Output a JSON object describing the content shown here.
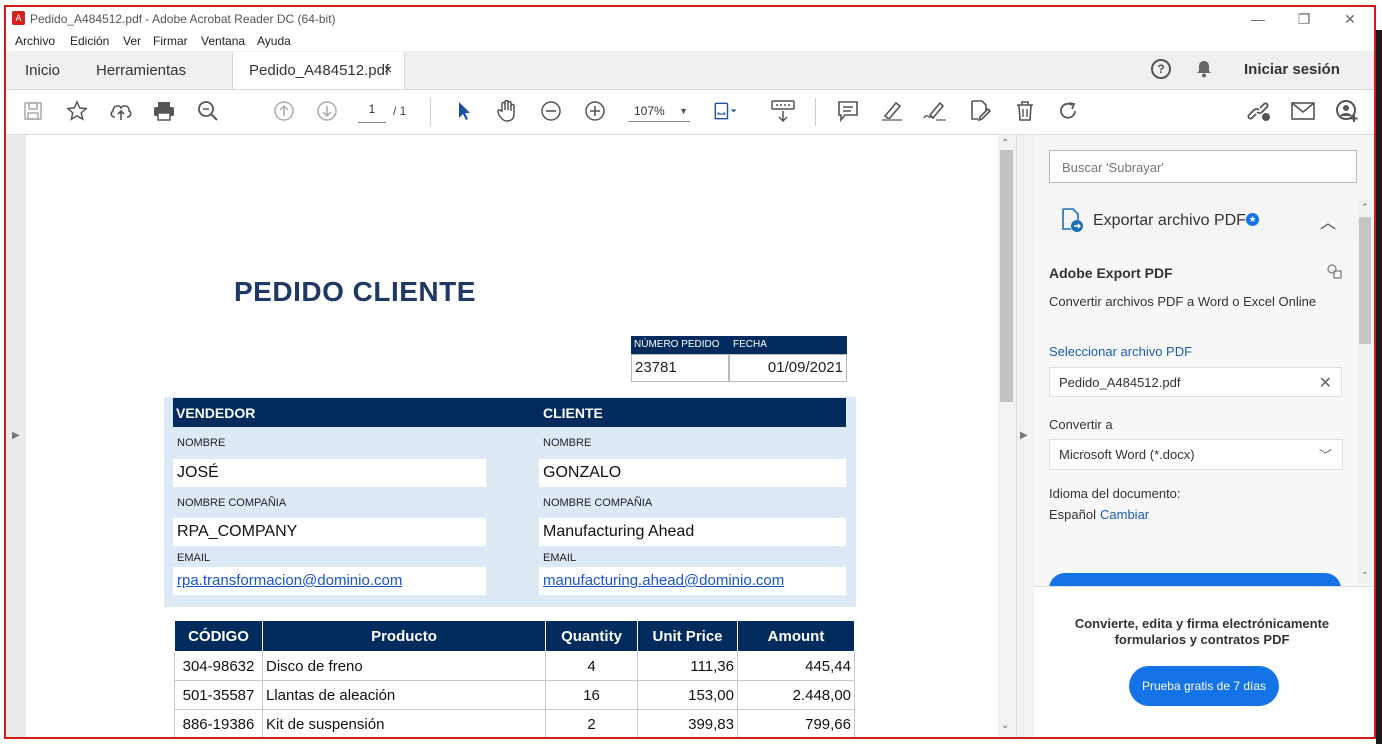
{
  "window": {
    "title": "Pedido_A484512.pdf - Adobe Acrobat Reader DC (64-bit)",
    "controls": [
      "—",
      "❐",
      "✕"
    ]
  },
  "menu": [
    "Archivo",
    "Edición",
    "Ver",
    "Firmar",
    "Ventana",
    "Ayuda"
  ],
  "tabs": {
    "home": "Inicio",
    "tools": "Herramientas",
    "document": "Pedido_A484512.pdf",
    "close": "×",
    "signin": "Iniciar sesión"
  },
  "toolbar": {
    "page_current": "1",
    "page_total": "/ 1",
    "zoom": "107%"
  },
  "document": {
    "title": "PEDIDO CLIENTE",
    "order_headers": [
      "NÚMERO PEDIDO",
      "FECHA"
    ],
    "order_number": "23781",
    "order_date": "01/09/2021",
    "vendor_header": "VENDEDOR",
    "client_header": "CLIENTE",
    "name_label": "NOMBRE",
    "company_label": "NOMBRE COMPAÑIA",
    "email_label": "EMAIL",
    "vendor": {
      "name": "JOSÉ",
      "company": "RPA_COMPANY",
      "email": "rpa.transformacion@dominio.com"
    },
    "client": {
      "name": "GONZALO",
      "company": "Manufacturing Ahead",
      "email": "manufacturing.ahead@dominio.com"
    },
    "items_headers": [
      "CÓDIGO",
      "Producto",
      "Quantity",
      "Unit Price",
      "Amount"
    ],
    "items": [
      [
        "304-98632",
        "Disco de freno",
        "4",
        "111,36",
        "445,44"
      ],
      [
        "501-35587",
        "Llantas de aleación",
        "16",
        "153,00",
        "2.448,00"
      ],
      [
        "886-19386",
        "Kit de suspensión",
        "2",
        "399,83",
        "799,66"
      ]
    ]
  },
  "right_panel": {
    "search_placeholder": "Buscar 'Subrayar'",
    "export_title": "Exportar archivo PDF",
    "section_title": "Adobe Export PDF",
    "section_desc": "Convertir archivos PDF a Word o Excel Online",
    "select_file_label": "Seleccionar archivo PDF",
    "selected_file": "Pedido_A484512.pdf",
    "convert_to_label": "Convertir a",
    "convert_to_value": "Microsoft Word (*.docx)",
    "doc_language_label": "Idioma del documento:",
    "doc_language_value": "Español",
    "change_link": "Cambiar",
    "promo_text": "Convierte, edita y firma electrónicamente formularios y contratos PDF",
    "trial_button": "Prueba gratis de 7 días"
  },
  "colors": {
    "navy": "#002b5c",
    "light_blue": "#dde9f5",
    "acrobat_blue": "#1473e6",
    "frame_red": "#d21c1c"
  }
}
